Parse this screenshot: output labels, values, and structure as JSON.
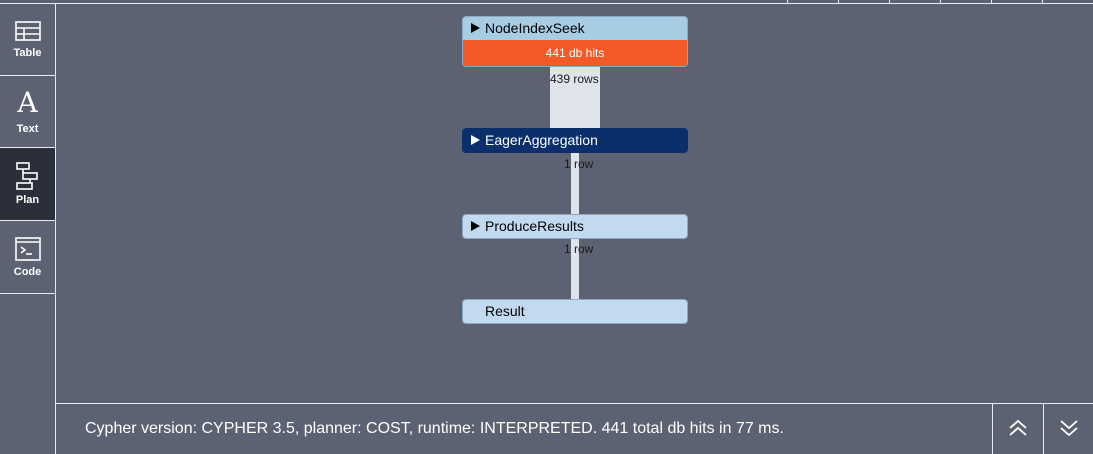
{
  "sidebar": {
    "items": [
      {
        "label": "Table",
        "icon": "table-icon",
        "active": false
      },
      {
        "label": "Text",
        "icon": "text-icon",
        "glyph": "A",
        "active": false
      },
      {
        "label": "Plan",
        "icon": "plan-icon",
        "active": true
      },
      {
        "label": "Code",
        "icon": "code-icon",
        "active": false
      }
    ]
  },
  "plan": {
    "operators": [
      {
        "name": "NodeIndexSeek",
        "db_hits": "441 db hits",
        "color": "#a6cde3"
      },
      {
        "name": "EagerAggregation",
        "color": "#0a2f6b"
      },
      {
        "name": "ProduceResults",
        "color": "#c3d9ef"
      },
      {
        "name": "Result",
        "color": "#c3d9ef"
      }
    ],
    "edges": [
      {
        "rows": "439 rows"
      },
      {
        "rows": "1 row"
      },
      {
        "rows": "1 row"
      }
    ]
  },
  "footer": {
    "message": "Cypher version: CYPHER 3.5, planner: COST, runtime: INTERPRETED. 441 total db hits in 77 ms.",
    "collapse_icon": "double-chevron-up-icon",
    "expand_icon": "double-chevron-down-icon"
  },
  "colors": {
    "background": "#5d6273",
    "active_tab": "#2b2f3a",
    "db_hits": "#f25a27"
  }
}
